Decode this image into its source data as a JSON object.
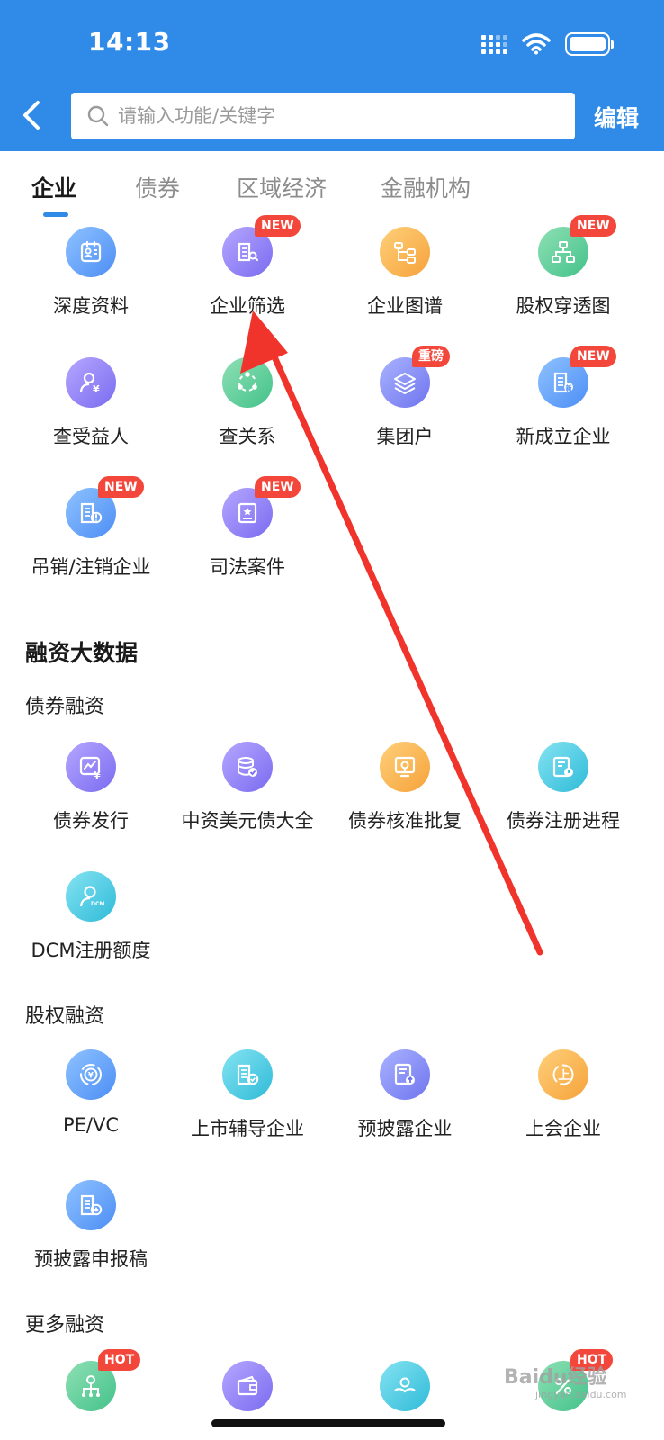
{
  "status_bar": {
    "time": "14:13"
  },
  "header": {
    "search_placeholder": "请输入功能/关键字",
    "edit_label": "编辑"
  },
  "tabs": [
    {
      "label": "企业",
      "active": true
    },
    {
      "label": "债券",
      "active": false
    },
    {
      "label": "区域经济",
      "active": false
    },
    {
      "label": "金融机构",
      "active": false
    }
  ],
  "enterprise_items": [
    {
      "label": "深度资料",
      "icon": "profile-card-icon",
      "badge": ""
    },
    {
      "label": "企业筛选",
      "icon": "building-search-icon",
      "badge": "NEW"
    },
    {
      "label": "企业图谱",
      "icon": "graph-tree-icon",
      "badge": ""
    },
    {
      "label": "股权穿透图",
      "icon": "org-chart-icon",
      "badge": "NEW"
    },
    {
      "label": "查受益人",
      "icon": "person-yen-icon",
      "badge": ""
    },
    {
      "label": "查关系",
      "icon": "relation-network-icon",
      "badge": ""
    },
    {
      "label": "集团户",
      "icon": "layers-icon",
      "badge": "重磅"
    },
    {
      "label": "新成立企业",
      "icon": "new-building-icon",
      "badge": "NEW"
    },
    {
      "label": "吊销/注销企业",
      "icon": "building-alert-icon",
      "badge": "NEW"
    },
    {
      "label": "司法案件",
      "icon": "judicial-document-icon",
      "badge": "NEW"
    }
  ],
  "financing_section": {
    "title": "融资大数据",
    "bond": {
      "title": "债券融资",
      "items": [
        {
          "label": "债券发行",
          "icon": "bond-chart-yen-icon",
          "badge": ""
        },
        {
          "label": "中资美元债大全",
          "icon": "database-check-icon",
          "badge": ""
        },
        {
          "label": "债券核准批复",
          "icon": "approval-stamp-icon",
          "badge": ""
        },
        {
          "label": "债券注册进程",
          "icon": "registration-clock-icon",
          "badge": ""
        },
        {
          "label": "DCM注册额度",
          "icon": "dcm-user-icon",
          "badge": ""
        }
      ]
    },
    "equity": {
      "title": "股权融资",
      "items": [
        {
          "label": "PE/VC",
          "icon": "yen-coin-icon",
          "badge": ""
        },
        {
          "label": "上市辅导企业",
          "icon": "building-check-icon",
          "badge": ""
        },
        {
          "label": "预披露企业",
          "icon": "document-upload-icon",
          "badge": ""
        },
        {
          "label": "上会企业",
          "icon": "listing-up-icon",
          "badge": ""
        },
        {
          "label": "预披露申报稿",
          "icon": "building-plus-icon",
          "badge": ""
        }
      ]
    },
    "more": {
      "title": "更多融资",
      "items": [
        {
          "label": "",
          "icon": "money-tree-icon",
          "badge": "HOT"
        },
        {
          "label": "",
          "icon": "wallet-icon",
          "badge": ""
        },
        {
          "label": "",
          "icon": "hands-icon",
          "badge": ""
        },
        {
          "label": "",
          "icon": "percent-icon",
          "badge": "HOT"
        }
      ]
    }
  },
  "watermark": {
    "text": "Baidu经验",
    "sub": "jingyan.baidu.com"
  },
  "colors": {
    "header_bg": "#2f8ae8",
    "badge_bg": "#f2473a",
    "annotation_arrow": "#f0332b"
  }
}
